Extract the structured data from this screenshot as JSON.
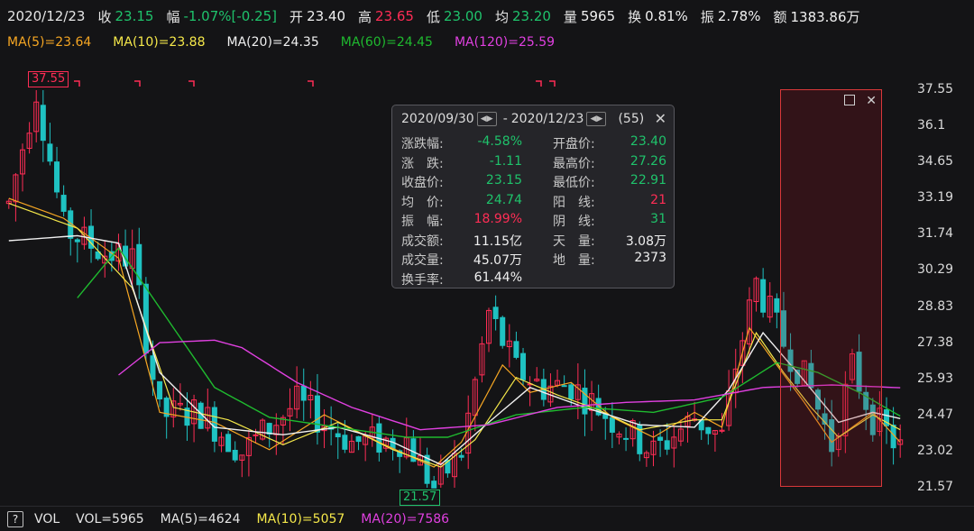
{
  "header": {
    "date": "2020/12/23",
    "close_label": "收",
    "close": "23.15",
    "change_label": "幅",
    "change": "-1.07%[-0.25]",
    "open_label": "开",
    "open": "23.40",
    "high_label": "高",
    "high": "23.65",
    "low_label": "低",
    "low": "23.00",
    "avg_label": "均",
    "avg": "23.20",
    "vol_label": "量",
    "vol": "5965",
    "turnover_label": "换",
    "turnover": "0.81%",
    "amp_label": "振",
    "amp": "2.78%",
    "amount_label": "额",
    "amount": "1383.86万"
  },
  "ma_bar": {
    "ma5": "MA(5)=23.64",
    "ma10": "MA(10)=23.88",
    "ma20": "MA(20)=24.35",
    "ma60": "MA(60)=24.45",
    "ma120": "MA(120)=25.59"
  },
  "colors": {
    "up": "#ff2d55",
    "down": "#1fc2c2",
    "ma5": "#f5a623",
    "ma10": "#f5e84a",
    "ma20": "#f0f0f0",
    "ma60": "#1fba2f",
    "ma120": "#e040e0",
    "bg": "#141416"
  },
  "price_axis": {
    "ticks": [
      "37.55",
      "36.1",
      "34.65",
      "33.19",
      "31.74",
      "30.29",
      "28.83",
      "27.38",
      "25.93",
      "24.47",
      "23.02",
      "21.57"
    ],
    "max": 37.55,
    "min": 21.57
  },
  "markers": {
    "high": "37.55",
    "low": "21.57"
  },
  "popup": {
    "start": "2020/09/30",
    "end": "2020/12/23",
    "count": "(55)",
    "separator": "-",
    "nav_left": "◀▶",
    "nav_right": "◀▶",
    "close": "✕",
    "rows": [
      {
        "k1": "涨跌幅:",
        "v1": "-4.58%",
        "k2": "开盘价:",
        "v2": "23.40"
      },
      {
        "k1": "涨　跌:",
        "v1": "-1.11",
        "k2": "最高价:",
        "v2": "27.26"
      },
      {
        "k1": "收盘价:",
        "v1": "23.15",
        "k2": "最低价:",
        "v2": "22.91"
      },
      {
        "k1": "均　价:",
        "v1": "24.74",
        "k2": "阳　线:",
        "v2": "21"
      },
      {
        "k1": "振　幅:",
        "v1": "18.99%",
        "k2": "阴　线:",
        "v2": "31"
      },
      {
        "k1": "成交额:",
        "v1": "11.15亿",
        "k2": "天　量:",
        "v2": "3.08万"
      },
      {
        "k1": "成交量:",
        "v1": "45.07万",
        "k2": "地　量:",
        "v2": "2373"
      },
      {
        "k1": "换手率:",
        "v1": "61.44%",
        "k2": "",
        "v2": ""
      }
    ]
  },
  "selection": {
    "restore_icon": "restore-icon",
    "close": "✕"
  },
  "footer": {
    "help": "?",
    "vol_label": "VOL",
    "vol": "VOL=5965",
    "ma5": "MA(5)=4624",
    "ma10": "MA(10)=5057",
    "ma20": "MA(20)=7586"
  },
  "chart_data": {
    "type": "candlestick",
    "ma_keypoints": {
      "ma5": [
        [
          0,
          33.2
        ],
        [
          8,
          32.4
        ],
        [
          16,
          30.8
        ],
        [
          22,
          24.6
        ],
        [
          30,
          24.2
        ],
        [
          38,
          23.1
        ],
        [
          46,
          24.5
        ],
        [
          54,
          23.4
        ],
        [
          62,
          22.4
        ],
        [
          66,
          23.4
        ],
        [
          72,
          26.5
        ],
        [
          76,
          25.4
        ],
        [
          82,
          25.8
        ],
        [
          88,
          24.4
        ],
        [
          94,
          23.6
        ],
        [
          100,
          24.6
        ],
        [
          104,
          24.0
        ],
        [
          108,
          28.0
        ],
        [
          112,
          26.5
        ],
        [
          116,
          25.0
        ],
        [
          120,
          23.4
        ],
        [
          126,
          24.6
        ],
        [
          130,
          23.4
        ]
      ],
      "ma10": [
        [
          0,
          33.0
        ],
        [
          10,
          32.0
        ],
        [
          18,
          29.6
        ],
        [
          24,
          24.8
        ],
        [
          32,
          24.3
        ],
        [
          40,
          23.3
        ],
        [
          48,
          24.2
        ],
        [
          56,
          23.1
        ],
        [
          63,
          22.4
        ],
        [
          68,
          23.5
        ],
        [
          74,
          26.0
        ],
        [
          80,
          25.3
        ],
        [
          86,
          24.7
        ],
        [
          92,
          23.9
        ],
        [
          100,
          24.3
        ],
        [
          104,
          24.3
        ],
        [
          109,
          27.8
        ],
        [
          113,
          26.2
        ],
        [
          117,
          24.8
        ],
        [
          121,
          23.6
        ],
        [
          126,
          24.5
        ],
        [
          130,
          23.9
        ]
      ],
      "ma20": [
        [
          0,
          31.5
        ],
        [
          10,
          31.7
        ],
        [
          16,
          31.4
        ],
        [
          22,
          26.2
        ],
        [
          30,
          24.0
        ],
        [
          40,
          23.7
        ],
        [
          48,
          24.0
        ],
        [
          56,
          23.4
        ],
        [
          63,
          22.5
        ],
        [
          70,
          24.2
        ],
        [
          76,
          25.6
        ],
        [
          84,
          24.8
        ],
        [
          92,
          24.1
        ],
        [
          100,
          24.0
        ],
        [
          105,
          25.5
        ],
        [
          110,
          27.8
        ],
        [
          115,
          26.2
        ],
        [
          121,
          24.2
        ],
        [
          126,
          24.6
        ],
        [
          130,
          24.35
        ]
      ],
      "ma60": [
        [
          10,
          29.2
        ],
        [
          16,
          31.2
        ],
        [
          22,
          28.8
        ],
        [
          30,
          25.6
        ],
        [
          38,
          24.4
        ],
        [
          48,
          24.0
        ],
        [
          58,
          23.6
        ],
        [
          64,
          23.6
        ],
        [
          74,
          24.5
        ],
        [
          84,
          24.8
        ],
        [
          94,
          24.6
        ],
        [
          104,
          25.2
        ],
        [
          112,
          26.6
        ],
        [
          118,
          26.2
        ],
        [
          124,
          25.4
        ],
        [
          130,
          24.45
        ]
      ],
      "ma120": [
        [
          16,
          26.1
        ],
        [
          22,
          27.4
        ],
        [
          30,
          27.5
        ],
        [
          34,
          27.2
        ],
        [
          42,
          25.8
        ],
        [
          50,
          24.8
        ],
        [
          60,
          23.9
        ],
        [
          70,
          24.1
        ],
        [
          80,
          24.8
        ],
        [
          90,
          25.0
        ],
        [
          100,
          25.1
        ],
        [
          110,
          25.6
        ],
        [
          120,
          25.7
        ],
        [
          130,
          25.59
        ]
      ]
    },
    "candles_envelope": [
      [
        0,
        33.0
      ],
      [
        4,
        37.55
      ],
      [
        8,
        32.0
      ],
      [
        14,
        31.0
      ],
      [
        18,
        30.8
      ],
      [
        22,
        24.5
      ],
      [
        28,
        24.6
      ],
      [
        34,
        23.0
      ],
      [
        42,
        25.0
      ],
      [
        50,
        23.4
      ],
      [
        58,
        23.5
      ],
      [
        62,
        21.57
      ],
      [
        66,
        23.0
      ],
      [
        70,
        28.6
      ],
      [
        74,
        26.3
      ],
      [
        78,
        25.6
      ],
      [
        82,
        25.7
      ],
      [
        88,
        24.3
      ],
      [
        94,
        23.0
      ],
      [
        100,
        24.4
      ],
      [
        104,
        23.6
      ],
      [
        106,
        26.5
      ],
      [
        109,
        29.8
      ],
      [
        113,
        27.4
      ],
      [
        117,
        25.5
      ],
      [
        120,
        23.3
      ],
      [
        123,
        26.4
      ],
      [
        126,
        24.4
      ],
      [
        130,
        23.15
      ]
    ],
    "count": 131,
    "ylim": [
      21.57,
      37.55
    ]
  }
}
